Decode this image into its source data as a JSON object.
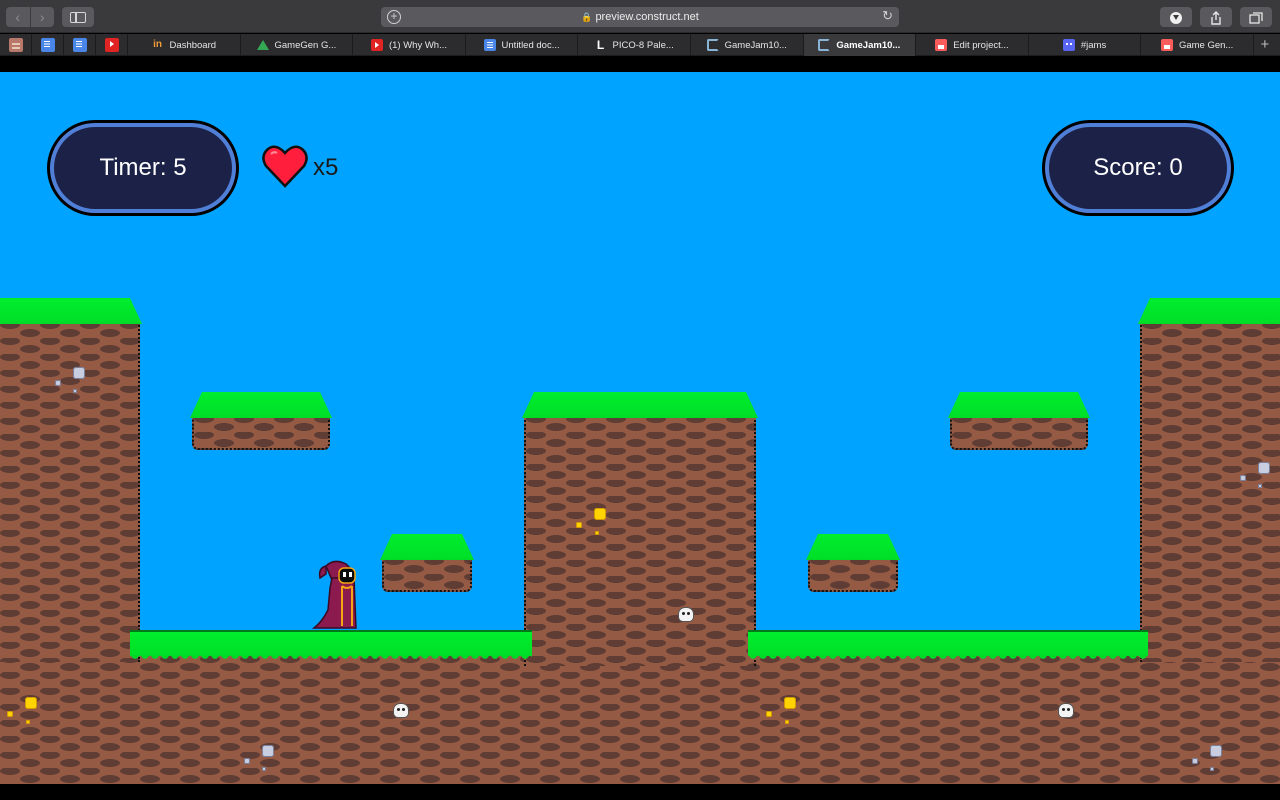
{
  "browser": {
    "address": "preview.construct.net",
    "tabs": [
      {
        "label": "Dashboard",
        "icon": "in-icon"
      },
      {
        "label": "GameGen G...",
        "icon": "drive-icon"
      },
      {
        "label": "(1) Why Wh...",
        "icon": "youtube-icon"
      },
      {
        "label": "Untitled doc...",
        "icon": "doc-icon"
      },
      {
        "label": "PICO-8 Pale...",
        "icon": "l-icon"
      },
      {
        "label": "GameJam10...",
        "icon": "construct-icon"
      },
      {
        "label": "GameJam10...",
        "icon": "construct-icon",
        "active": true
      },
      {
        "label": "Edit project...",
        "icon": "itch-icon"
      },
      {
        "label": "#jams",
        "icon": "discord-icon"
      },
      {
        "label": "Game Gen...",
        "icon": "itch-icon"
      }
    ]
  },
  "hud": {
    "timer": "Timer: 5",
    "lives": "x5",
    "score": "Score: 0"
  },
  "colors": {
    "sky": "#00a3ff",
    "grass": "#00ee2c",
    "dirt": "#955a44",
    "hud_fill": "#1c2247",
    "hud_border": "#4f7fd6",
    "heart": "#ff1e3c",
    "wizard_robe": "#8b1a4f"
  }
}
